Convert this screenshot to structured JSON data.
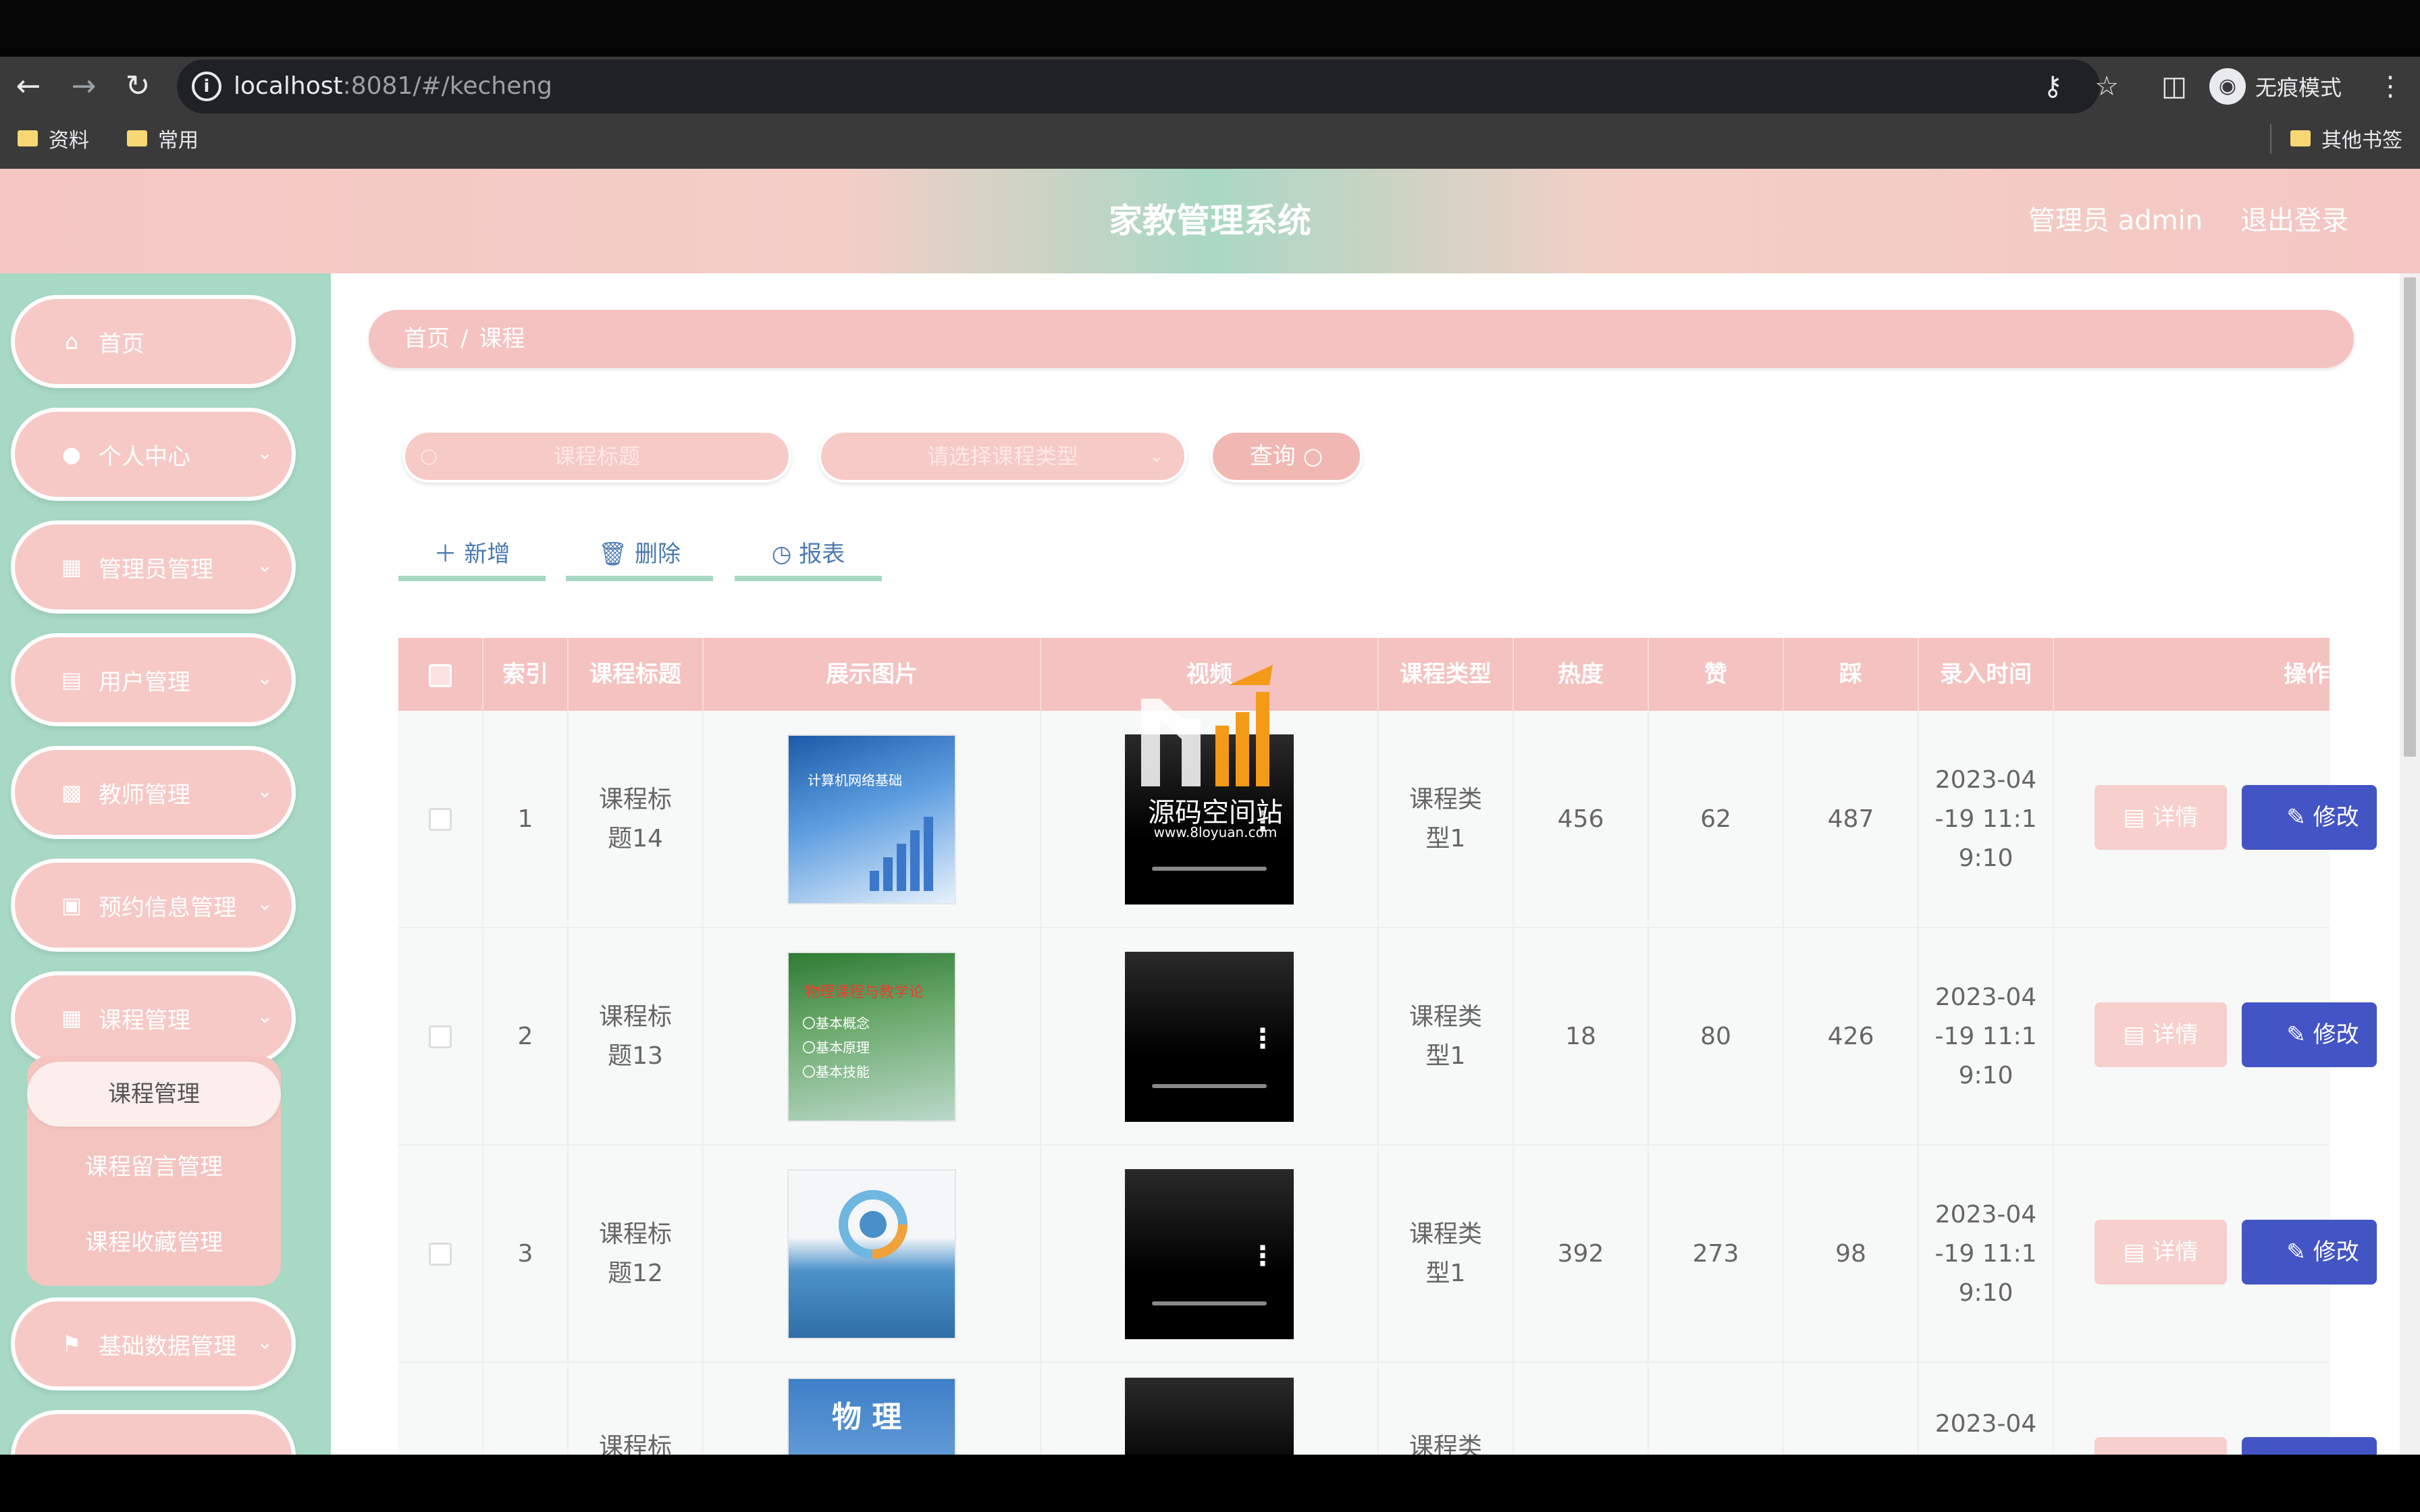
{
  "browser": {
    "url_host": "localhost",
    "url_rest": ":8081/#/kecheng",
    "incognito_label": "无痕模式",
    "bookmarks": [
      "资料",
      "常用"
    ],
    "other_bookmarks": "其他书签"
  },
  "header": {
    "title": "家教管理系统",
    "user": "管理员 admin",
    "logout": "退出登录"
  },
  "sidebar": {
    "items": [
      {
        "label": "首页",
        "icon": "home-icon"
      },
      {
        "label": "个人中心",
        "icon": "user-icon"
      },
      {
        "label": "管理员管理",
        "icon": "grid-icon"
      },
      {
        "label": "用户管理",
        "icon": "clipboard-icon"
      },
      {
        "label": "教师管理",
        "icon": "apps-icon"
      },
      {
        "label": "预约信息管理",
        "icon": "briefcase-icon"
      },
      {
        "label": "课程管理",
        "icon": "grid-icon"
      },
      {
        "label": "基础数据管理",
        "icon": "flag-icon"
      }
    ],
    "submenu": [
      "课程管理",
      "课程留言管理",
      "课程收藏管理"
    ]
  },
  "breadcrumb": {
    "home": "首页",
    "sep": "/",
    "current": "课程"
  },
  "search": {
    "title_placeholder": "课程标题",
    "type_placeholder": "请选择课程类型",
    "query_label": "查询"
  },
  "actions": {
    "add": "新增",
    "delete": "删除",
    "report": "报表"
  },
  "table": {
    "headers": [
      "索引",
      "课程标题",
      "展示图片",
      "视频",
      "课程类型",
      "热度",
      "赞",
      "踩",
      "录入时间",
      "操作"
    ],
    "rows": [
      {
        "index": "1",
        "title": "课程标题14",
        "type": "课程类型1",
        "heat": "456",
        "likes": "62",
        "dislikes": "487",
        "time": "2023-04-19 11:19:10"
      },
      {
        "index": "2",
        "title": "课程标题13",
        "type": "课程类型1",
        "heat": "18",
        "likes": "80",
        "dislikes": "426",
        "time": "2023-04-19 11:19:10"
      },
      {
        "index": "3",
        "title": "课程标题12",
        "type": "课程类型1",
        "heat": "392",
        "likes": "273",
        "dislikes": "98",
        "time": "2023-04-19 11:19:10"
      },
      {
        "index": "",
        "title": "课程标题",
        "type": "课程类型",
        "heat": "",
        "likes": "",
        "dislikes": "",
        "time": "2023-04"
      }
    ],
    "detail_label": "详情",
    "edit_label": "修改"
  },
  "covers": {
    "c1_text": "计算机网络基础",
    "c2_text": "物理课程与教学论",
    "c2_lines": [
      "〇基本概念",
      "〇基本原理",
      "〇基本技能"
    ],
    "c4_text": "物 理"
  },
  "watermark": {
    "text": "源码空间站",
    "url": "www.8loyuan.com"
  },
  "colors": {
    "pink": "#f4c2c0",
    "mint": "#a7d9c5",
    "blue": "#4355c4"
  }
}
